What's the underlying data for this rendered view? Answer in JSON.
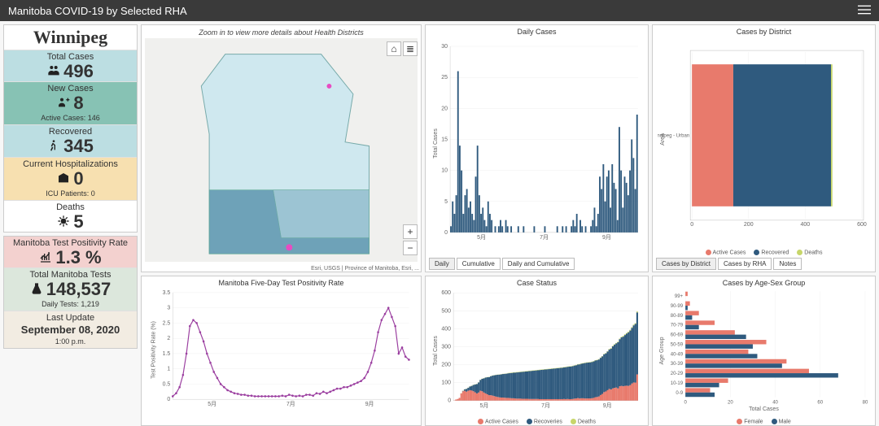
{
  "header": {
    "title": "Manitoba COVID-19 by Selected RHA"
  },
  "region": "Winnipeg",
  "colors": {
    "active": "#e87a6c",
    "recovered": "#2f5a7e",
    "deaths": "#c7d66a",
    "female": "#e87a6c",
    "male": "#2f5a7e",
    "positivity": "#9b3fa0"
  },
  "stats": {
    "total_cases": {
      "label": "Total Cases",
      "value": "496"
    },
    "new_cases": {
      "label": "New Cases",
      "value": "8",
      "sub": "Active Cases: 146"
    },
    "recovered": {
      "label": "Recovered",
      "value": "345"
    },
    "hospital": {
      "label": "Current Hospitalizations",
      "value": "0",
      "sub": "ICU Patients: 0"
    },
    "deaths": {
      "label": "Deaths",
      "value": "5"
    },
    "positivity": {
      "label": "Manitoba Test Positivity Rate",
      "value": "1.3 %"
    },
    "total_tests": {
      "label": "Total Manitoba Tests",
      "value": "148,537",
      "sub": "Daily Tests: 1,219"
    },
    "last_update": {
      "label": "Last Update",
      "value": "September 08, 2020",
      "sub": "1:00 p.m."
    }
  },
  "map": {
    "hint": "Zoom in to view more details about Health Districts",
    "attribution": "Esri, USGS | Province of Manitoba, Esri, ..."
  },
  "panels": {
    "daily_cases": {
      "title": "Daily Cases",
      "tabs": [
        "Daily",
        "Cumulative",
        "Daily and Cumulative"
      ],
      "active_tab": 0,
      "ylabel": "Total Cases"
    },
    "positivity_chart": {
      "title": "Manitoba Five-Day Test Positivity Rate",
      "ylabel": "Test Positivity Rate (%)"
    },
    "case_status": {
      "title": "Case Status",
      "ylabel": "Total Cases",
      "legend": [
        "Active Cases",
        "Recoveries",
        "Deaths"
      ]
    },
    "by_district": {
      "title": "Cases by District",
      "tabs": [
        "Cases by District",
        "Cases by RHA",
        "Notes"
      ],
      "active_tab": 0,
      "ylabel": "Area",
      "legend": [
        "Active Cases",
        "Recovered",
        "Deaths"
      ]
    },
    "age_sex": {
      "title": "Cases by Age-Sex Group",
      "xlabel": "Total Cases",
      "ylabel": "Age Group",
      "legend": [
        "Female",
        "Male"
      ]
    }
  },
  "month_ticks": [
    "5月",
    "7月",
    "9月"
  ],
  "chart_data": [
    {
      "id": "daily_cases",
      "type": "bar",
      "xlabel": "",
      "ylabel": "Total Cases",
      "ylim": [
        0,
        30
      ],
      "title": "Daily Cases",
      "x_ticks": [
        "5月",
        "7月",
        "9月"
      ],
      "values": [
        1,
        5,
        3,
        6,
        26,
        14,
        10,
        3,
        6,
        7,
        4,
        5,
        3,
        2,
        9,
        14,
        6,
        3,
        4,
        2,
        1,
        5,
        3,
        2,
        0,
        1,
        0,
        1,
        2,
        1,
        0,
        2,
        1,
        0,
        1,
        0,
        0,
        0,
        1,
        0,
        0,
        1,
        0,
        0,
        0,
        0,
        0,
        1,
        0,
        0,
        0,
        0,
        0,
        1,
        0,
        0,
        0,
        0,
        0,
        0,
        1,
        0,
        0,
        1,
        0,
        1,
        0,
        0,
        1,
        2,
        1,
        3,
        0,
        2,
        1,
        0,
        1,
        0,
        0,
        1,
        2,
        4,
        1,
        3,
        9,
        7,
        11,
        5,
        9,
        10,
        4,
        11,
        8,
        7,
        2,
        17,
        10,
        4,
        9,
        8,
        6,
        10,
        15,
        12,
        7,
        19
      ]
    },
    {
      "id": "positivity",
      "type": "line",
      "xlabel": "",
      "ylabel": "Test Positivity Rate (%)",
      "ylim": [
        0,
        3.5
      ],
      "title": "Manitoba Five-Day Test Positivity Rate",
      "x_ticks": [
        "5月",
        "7月",
        "9月"
      ],
      "values": [
        0.1,
        0.2,
        0.4,
        0.8,
        1.5,
        2.4,
        2.6,
        2.5,
        2.2,
        1.9,
        1.5,
        1.2,
        0.9,
        0.7,
        0.5,
        0.4,
        0.3,
        0.25,
        0.2,
        0.18,
        0.15,
        0.15,
        0.12,
        0.12,
        0.1,
        0.1,
        0.1,
        0.1,
        0.1,
        0.1,
        0.1,
        0.1,
        0.12,
        0.1,
        0.15,
        0.12,
        0.1,
        0.12,
        0.1,
        0.15,
        0.15,
        0.12,
        0.2,
        0.18,
        0.25,
        0.2,
        0.25,
        0.3,
        0.35,
        0.35,
        0.4,
        0.4,
        0.45,
        0.5,
        0.55,
        0.6,
        0.7,
        0.9,
        1.2,
        1.6,
        2.2,
        2.6,
        2.8,
        3.0,
        2.7,
        2.4,
        1.5,
        1.7,
        1.4,
        1.3
      ]
    },
    {
      "id": "case_status",
      "type": "area",
      "xlabel": "",
      "ylabel": "Total Cases",
      "ylim": [
        0,
        600
      ],
      "title": "Case Status",
      "x_ticks": [
        "5月",
        "7月",
        "9月"
      ],
      "series": [
        {
          "name": "Active Cases",
          "color": "#e87a6c"
        },
        {
          "name": "Recoveries",
          "color": "#2f5a7e"
        },
        {
          "name": "Deaths",
          "color": "#c7d66a"
        }
      ],
      "active": [
        1,
        6,
        9,
        15,
        40,
        52,
        55,
        50,
        55,
        58,
        56,
        52,
        46,
        40,
        45,
        55,
        52,
        45,
        40,
        35,
        30,
        30,
        28,
        25,
        22,
        20,
        18,
        17,
        17,
        16,
        15,
        15,
        14,
        13,
        13,
        12,
        11,
        11,
        11,
        10,
        10,
        10,
        10,
        9,
        9,
        9,
        9,
        9,
        9,
        8,
        8,
        8,
        8,
        8,
        8,
        8,
        8,
        8,
        8,
        8,
        8,
        8,
        8,
        9,
        8,
        9,
        8,
        8,
        9,
        11,
        12,
        14,
        12,
        13,
        13,
        12,
        12,
        12,
        12,
        13,
        15,
        19,
        20,
        23,
        31,
        37,
        47,
        51,
        58,
        65,
        62,
        68,
        71,
        73,
        68,
        80,
        82,
        80,
        82,
        83,
        82,
        86,
        95,
        101,
        100,
        146
      ],
      "recovered": [
        0,
        0,
        0,
        0,
        0,
        2,
        7,
        15,
        16,
        20,
        26,
        35,
        44,
        52,
        56,
        60,
        69,
        79,
        88,
        95,
        101,
        106,
        111,
        116,
        121,
        124,
        127,
        129,
        131,
        133,
        135,
        137,
        139,
        141,
        142,
        144,
        146,
        147,
        148,
        150,
        151,
        152,
        153,
        155,
        156,
        157,
        158,
        159,
        160,
        162,
        163,
        164,
        165,
        166,
        167,
        168,
        169,
        170,
        171,
        172,
        173,
        174,
        175,
        176,
        178,
        179,
        181,
        182,
        183,
        184,
        185,
        187,
        190,
        192,
        194,
        197,
        199,
        200,
        201,
        202,
        203,
        204,
        205,
        206,
        207,
        209,
        211,
        212,
        215,
        219,
        227,
        234,
        240,
        245,
        257,
        262,
        270,
        276,
        283,
        290,
        298,
        304,
        310,
        318,
        327,
        345
      ],
      "deaths": [
        0,
        0,
        0,
        0,
        1,
        1,
        1,
        1,
        1,
        1,
        1,
        1,
        1,
        1,
        1,
        1,
        1,
        1,
        1,
        1,
        1,
        1,
        1,
        1,
        1,
        1,
        1,
        1,
        1,
        1,
        1,
        2,
        2,
        2,
        2,
        2,
        2,
        2,
        2,
        2,
        2,
        2,
        2,
        2,
        2,
        2,
        2,
        2,
        2,
        2,
        2,
        2,
        2,
        2,
        2,
        2,
        2,
        2,
        2,
        2,
        2,
        2,
        2,
        2,
        2,
        2,
        2,
        2,
        2,
        2,
        2,
        2,
        2,
        2,
        2,
        2,
        2,
        2,
        2,
        2,
        2,
        2,
        2,
        2,
        2,
        2,
        2,
        2,
        2,
        3,
        3,
        3,
        3,
        3,
        3,
        3,
        3,
        4,
        4,
        4,
        4,
        4,
        4,
        4,
        4,
        5
      ]
    },
    {
      "id": "by_district",
      "type": "bar",
      "orientation": "horizontal",
      "title": "Cases by District",
      "xlabel": "",
      "ylabel": "Area",
      "xlim": [
        0,
        600
      ],
      "x_ticks": [
        0,
        200,
        400,
        600
      ],
      "categories": [
        "Winnipeg - Urban"
      ],
      "series": [
        {
          "name": "Active Cases",
          "values": [
            146
          ],
          "color": "#e87a6c"
        },
        {
          "name": "Recovered",
          "values": [
            345
          ],
          "color": "#2f5a7e"
        },
        {
          "name": "Deaths",
          "values": [
            5
          ],
          "color": "#c7d66a"
        }
      ]
    },
    {
      "id": "age_sex",
      "type": "bar",
      "orientation": "horizontal",
      "title": "Cases by Age-Sex Group",
      "xlabel": "Total Cases",
      "ylabel": "Age Group",
      "xlim": [
        0,
        80
      ],
      "x_ticks": [
        0,
        20,
        40,
        60,
        80
      ],
      "categories": [
        "99+",
        "90-99",
        "80-89",
        "70-79",
        "60-69",
        "50-59",
        "40-49",
        "30-39",
        "20-29",
        "10-19",
        "0-9"
      ],
      "series": [
        {
          "name": "Female",
          "color": "#e87a6c",
          "values": [
            1,
            2,
            6,
            13,
            22,
            36,
            28,
            45,
            55,
            19,
            11
          ]
        },
        {
          "name": "Male",
          "color": "#2f5a7e",
          "values": [
            0,
            1,
            3,
            6,
            27,
            30,
            32,
            43,
            68,
            15,
            13
          ]
        }
      ]
    }
  ]
}
